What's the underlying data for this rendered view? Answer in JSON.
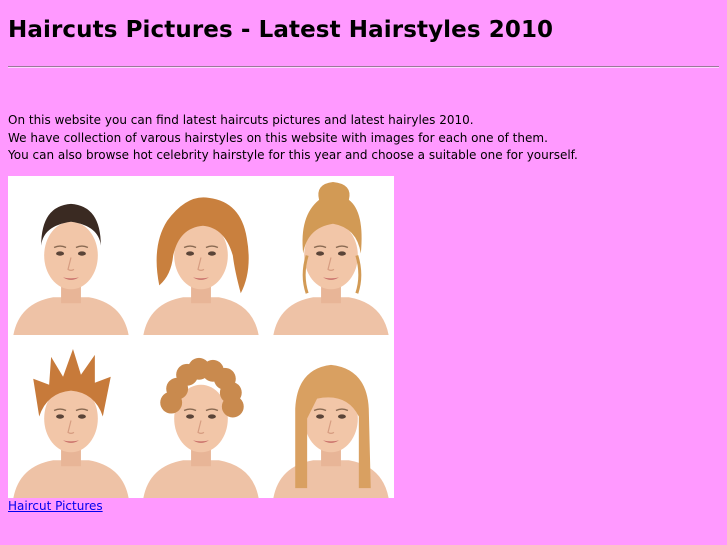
{
  "page": {
    "title": "Haircuts Pictures - Latest Hairstyles 2010",
    "background": "#ff99ff"
  },
  "intro": {
    "lines": [
      "On this website you can find latest haircuts pictures and latest hairyles 2010.",
      "We have collection of varous hairstyles on this website with images for each one of them.",
      "You can also browse hot celebrity hairstyle for this year and choose a suitable one for yourself."
    ]
  },
  "gallery": {
    "tiles": [
      {
        "hair": "dark-slicked-back",
        "hair_color": "#3a2a22"
      },
      {
        "hair": "wavy-bob",
        "hair_color": "#c9803e"
      },
      {
        "hair": "messy-updo",
        "hair_color": "#d29a55"
      },
      {
        "hair": "spiky-pixie",
        "hair_color": "#c77a3a"
      },
      {
        "hair": "curly-crop",
        "hair_color": "#c98a4e"
      },
      {
        "hair": "long-straight-fringe",
        "hair_color": "#d9a061"
      }
    ]
  },
  "footer": {
    "link_label": "Haircut Pictures",
    "link_color": "#0000ee"
  }
}
